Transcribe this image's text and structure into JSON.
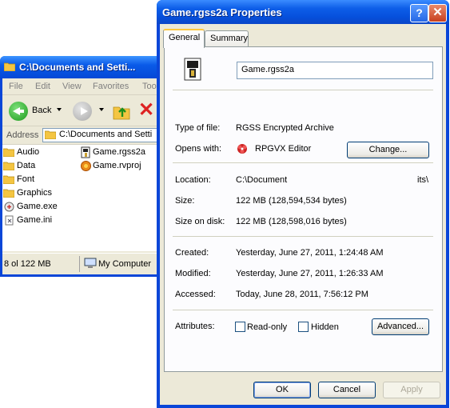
{
  "explorer": {
    "title": "C:\\Documents and Setti...",
    "menu": [
      "File",
      "Edit",
      "View",
      "Favorites",
      "Too"
    ],
    "back_label": "Back",
    "address_label": "Address",
    "address_value": "C:\\Documents and Setti",
    "files": [
      {
        "name": "Audio",
        "icon": "folder-icon"
      },
      {
        "name": "Data",
        "icon": "folder-icon"
      },
      {
        "name": "Font",
        "icon": "folder-icon"
      },
      {
        "name": "Graphics",
        "icon": "folder-icon"
      },
      {
        "name": "Game.exe",
        "icon": "exe-icon"
      },
      {
        "name": "Game.ini",
        "icon": "ini-icon"
      },
      {
        "name": "Game.rgss2a",
        "icon": "archive-icon"
      },
      {
        "name": "Game.rvproj",
        "icon": "rpg-project-icon"
      }
    ],
    "status_left": "8 ol 122 MB",
    "status_right": "My Computer"
  },
  "dialog": {
    "title": "Game.rgss2a Properties",
    "help": "?",
    "close": "✕",
    "tabs": [
      "General",
      "Summary"
    ],
    "filename": "Game.rgss2a",
    "type_label": "Type of file:",
    "type_value": "RGSS Encrypted Archive",
    "opens_label": "Opens with:",
    "opens_value": "RPGVX Editor",
    "change_button": "Change...",
    "location_label": "Location:",
    "location_value_start": "C:\\Document",
    "location_value_end": "its\\",
    "size_label": "Size:",
    "size_value": "122 MB (128,594,534 bytes)",
    "size_disk_label": "Size on disk:",
    "size_disk_value": "122 MB (128,598,016 bytes)",
    "created_label": "Created:",
    "created_value": "Yesterday, June 27, 2011, 1:24:48 AM",
    "modified_label": "Modified:",
    "modified_value": "Yesterday, June 27, 2011, 1:26:33 AM",
    "accessed_label": "Accessed:",
    "accessed_value": "Today, June 28, 2011, 7:56:12 PM",
    "attributes_label": "Attributes:",
    "readonly_label": "Read-only",
    "hidden_label": "Hidden",
    "readonly_checked": false,
    "hidden_checked": false,
    "advanced_button": "Advanced...",
    "ok_button": "OK",
    "cancel_button": "Cancel",
    "apply_button": "Apply"
  },
  "colors": {
    "titlebar": "#0a5ae8",
    "dialog_face": "#ece9d8",
    "panel": "#fcfcfe",
    "tab_highlight": "#ffc83c"
  }
}
